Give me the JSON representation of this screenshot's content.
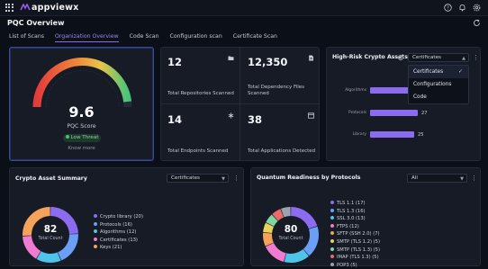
{
  "app": {
    "name": "appviewx"
  },
  "page": {
    "title": "PQC Overview"
  },
  "tabs": [
    {
      "label": "List of Scans",
      "active": false
    },
    {
      "label": "Organization Overview",
      "active": true
    },
    {
      "label": "Code Scan",
      "active": false
    },
    {
      "label": "Configuration scan",
      "active": false
    },
    {
      "label": "Certificate Scan",
      "active": false
    }
  ],
  "pqc": {
    "score": "9.6",
    "label": "PQC Score",
    "threat": "Low Threat",
    "know_more": "Know more",
    "gauge_fraction": 0.96
  },
  "stats": [
    {
      "value": "12",
      "label": "Total Repositories Scanned",
      "icon": "folder-icon"
    },
    {
      "value": "12,350",
      "label": "Total Dependency Files Scanned",
      "icon": "file-icon"
    },
    {
      "value": "14",
      "label": "Total Endpoints Scanned",
      "icon": "asterisk-icon"
    },
    {
      "value": "38",
      "label": "Total Applications Detected",
      "icon": "app-window-icon"
    }
  ],
  "risk": {
    "title": "High-Risk Crypto Assets",
    "select_value": "Certificates",
    "options": [
      {
        "label": "Certificates",
        "selected": true
      },
      {
        "label": "Configurations",
        "selected": false
      },
      {
        "label": "Code",
        "selected": false
      }
    ],
    "bars": [
      {
        "label": "Algorithms",
        "value": "",
        "fraction": 0.55
      },
      {
        "label": "Protocols",
        "value": "27",
        "fraction": 0.58
      },
      {
        "label": "Library",
        "value": "25",
        "fraction": 0.53
      }
    ]
  },
  "summary": {
    "title": "Crypto Asset Summary",
    "select_value": "Certificates",
    "total": "82",
    "total_label": "Total Count",
    "legend": [
      {
        "label": "Crypto library (20)",
        "color": "#8b6cf0"
      },
      {
        "label": "Protocols (16)",
        "color": "#6b9ef5"
      },
      {
        "label": "Algorithms (12)",
        "color": "#4fc3e8"
      },
      {
        "label": "Certificates (13)",
        "color": "#f07bd0"
      },
      {
        "label": "Keys (21)",
        "color": "#f5a25a"
      }
    ]
  },
  "quantum": {
    "title": "Quantum Readiness by Protocols",
    "select_value": "All",
    "total": "80",
    "total_label": "Total Count",
    "legend": [
      {
        "label": "TLS 1.1 (17)",
        "color": "#8b6cf0"
      },
      {
        "label": "TLS 1.3 (16)",
        "color": "#6b9ef5"
      },
      {
        "label": "SSL 3.0 (13)",
        "color": "#4fc3e8"
      },
      {
        "label": "FTPS (12)",
        "color": "#f07bd0"
      },
      {
        "label": "SFTP (SSH 2.0) (7)",
        "color": "#f5a25a"
      },
      {
        "label": "SMTP (TLS 1.2) (5)",
        "color": "#e8d25a"
      },
      {
        "label": "SMTP (TLS 1.3) (5)",
        "color": "#7fd6a1"
      },
      {
        "label": "IMAP (TLS 1.3) (5)",
        "color": "#e86a6a"
      },
      {
        "label": "POP3 (5)",
        "color": "#9ca2b0"
      }
    ]
  }
}
